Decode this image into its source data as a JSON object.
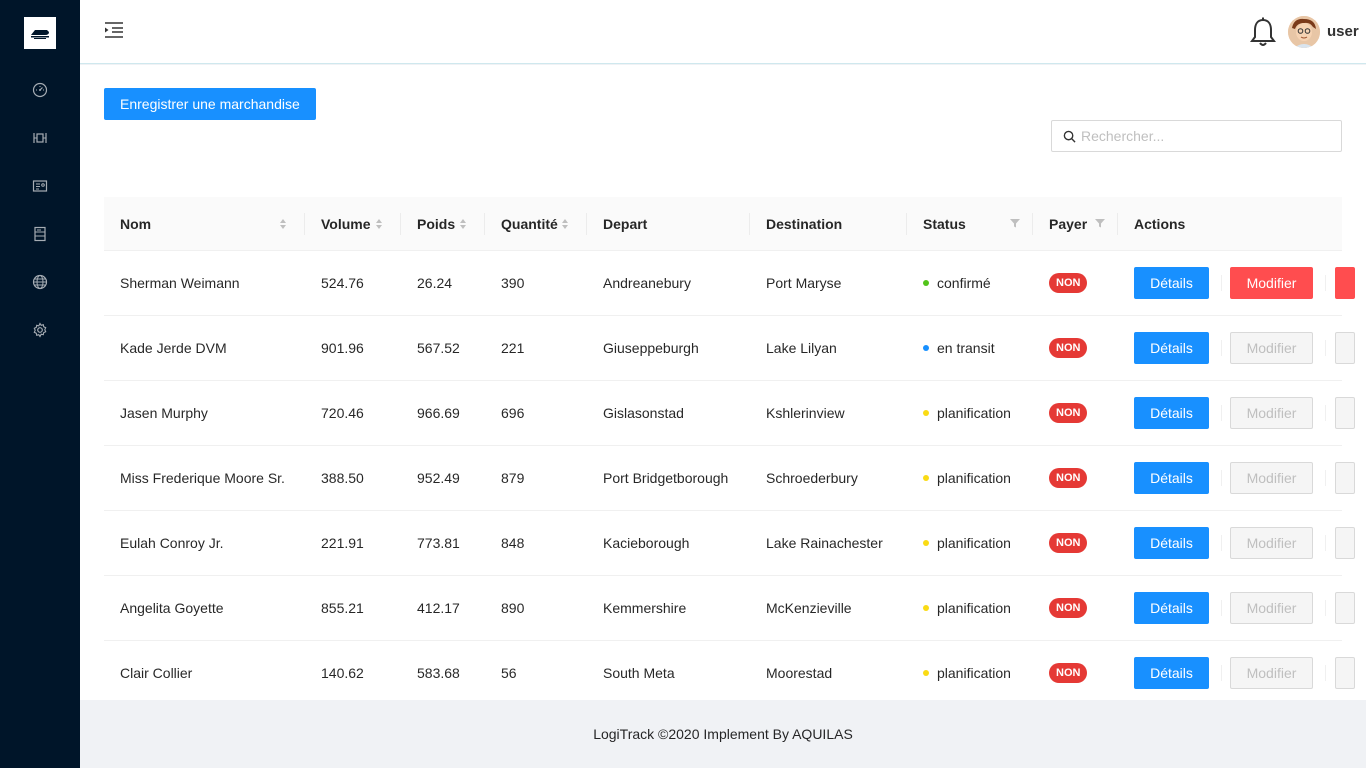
{
  "header": {
    "username": "user"
  },
  "sidebar": {
    "items": [
      {
        "icon": "dashboard-icon"
      },
      {
        "icon": "column-width-icon"
      },
      {
        "icon": "idcard-icon"
      },
      {
        "icon": "container-icon"
      },
      {
        "icon": "global-icon"
      },
      {
        "icon": "setting-icon"
      }
    ]
  },
  "main": {
    "register_button": "Enregistrer une marchandise",
    "search_placeholder": "Rechercher...",
    "columns": [
      "Nom",
      "Volume",
      "Poids",
      "Quantité",
      "Depart",
      "Destination",
      "Status",
      "Payer",
      "Actions"
    ],
    "details_label": "Détails",
    "modify_label": "Modifier",
    "rows": [
      {
        "nom": "Sherman Weimann",
        "volume": "524.76",
        "poids": "26.24",
        "quantite": "390",
        "depart": "Andreanebury",
        "destination": "Port Maryse",
        "status": "confirmé",
        "status_color": "#52c41a",
        "payer": "NON",
        "modify_active": true
      },
      {
        "nom": "Kade Jerde DVM",
        "volume": "901.96",
        "poids": "567.52",
        "quantite": "221",
        "depart": "Giuseppeburgh",
        "destination": "Lake Lilyan",
        "status": "en transit",
        "status_color": "#1890ff",
        "payer": "NON",
        "modify_active": false
      },
      {
        "nom": "Jasen Murphy",
        "volume": "720.46",
        "poids": "966.69",
        "quantite": "696",
        "depart": "Gislasonstad",
        "destination": "Kshlerinview",
        "status": "planification",
        "status_color": "#fadb14",
        "payer": "NON",
        "modify_active": false
      },
      {
        "nom": "Miss Frederique Moore Sr.",
        "volume": "388.50",
        "poids": "952.49",
        "quantite": "879",
        "depart": "Port Bridgetborough",
        "destination": "Schroederbury",
        "status": "planification",
        "status_color": "#fadb14",
        "payer": "NON",
        "modify_active": false
      },
      {
        "nom": "Eulah Conroy Jr.",
        "volume": "221.91",
        "poids": "773.81",
        "quantite": "848",
        "depart": "Kacieborough",
        "destination": "Lake Rainachester",
        "status": "planification",
        "status_color": "#fadb14",
        "payer": "NON",
        "modify_active": false
      },
      {
        "nom": "Angelita Goyette",
        "volume": "855.21",
        "poids": "412.17",
        "quantite": "890",
        "depart": "Kemmershire",
        "destination": "McKenzieville",
        "status": "planification",
        "status_color": "#fadb14",
        "payer": "NON",
        "modify_active": false
      },
      {
        "nom": "Clair Collier",
        "volume": "140.62",
        "poids": "583.68",
        "quantite": "56",
        "depart": "South Meta",
        "destination": "Moorestad",
        "status": "planification",
        "status_color": "#fadb14",
        "payer": "NON",
        "modify_active": false
      }
    ]
  },
  "footer": {
    "text": "LogiTrack ©2020 Implement By AQUILAS"
  }
}
